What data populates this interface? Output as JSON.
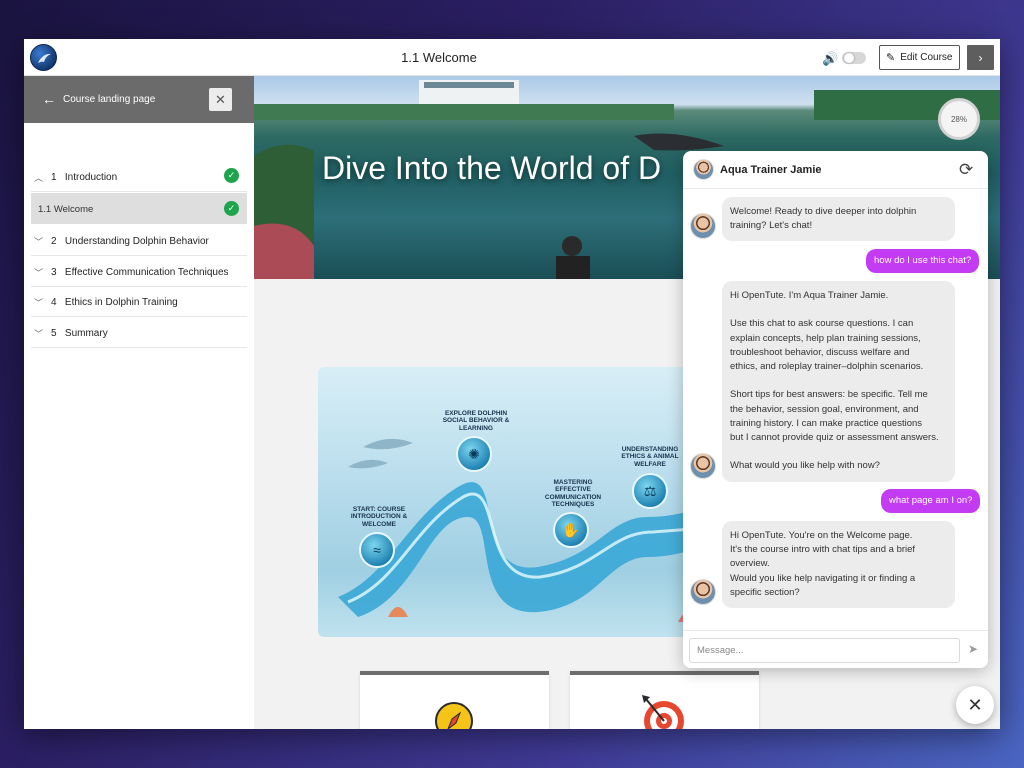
{
  "header": {
    "page_title": "1.1 Welcome",
    "edit_course_label": "Edit Course",
    "icons": {
      "logo": "dolphin-logo-icon",
      "speaker": "speaker-icon",
      "edit": "edit-icon",
      "next": "chevron-right-icon"
    }
  },
  "sidebar": {
    "back_label": "Course landing page",
    "sections": [
      {
        "number": "1",
        "title": "Introduction",
        "expanded": true,
        "completed": true
      },
      {
        "number": "2",
        "title": "Understanding Dolphin Behavior",
        "expanded": false,
        "completed": false
      },
      {
        "number": "3",
        "title": "Effective Communication Techniques",
        "expanded": false,
        "completed": false
      },
      {
        "number": "4",
        "title": "Ethics in Dolphin Training",
        "expanded": false,
        "completed": false
      },
      {
        "number": "5",
        "title": "Summary",
        "expanded": false,
        "completed": false
      }
    ],
    "lessons": [
      {
        "title": "1.1 Welcome",
        "completed": true,
        "active": true
      }
    ]
  },
  "main": {
    "hero_title": "Dive Into the World of D",
    "progress": {
      "label": "28%",
      "value": 0.28
    },
    "roadmap": {
      "stops": [
        {
          "label": "START: COURSE INTRODUCTION & WELCOME",
          "icon": "wave-icon"
        },
        {
          "label": "EXPLORE DOLPHIN SOCIAL BEHAVIOR & LEARNING",
          "icon": "brain-icon"
        },
        {
          "label": "MASTERING EFFECTIVE COMMUNICATION TECHNIQUES",
          "icon": "hand-signal-icon"
        },
        {
          "label": "UNDERSTANDING ETHICS & ANIMAL WELFARE",
          "icon": "scales-icon"
        }
      ]
    },
    "cards": [
      {
        "icon": "compass-icon"
      },
      {
        "icon": "target-icon"
      }
    ]
  },
  "chat": {
    "assistant_name": "Aqua Trainer Jamie",
    "input_placeholder": "Message...",
    "messages": [
      {
        "role": "assistant",
        "text": "Welcome! Ready to dive deeper into dolphin\ntraining? Let's chat!"
      },
      {
        "role": "user",
        "text": "how do I use this chat?"
      },
      {
        "role": "assistant",
        "text": "Hi OpenTute. I'm Aqua Trainer Jamie.\n\nUse this chat to ask course questions. I can\nexplain concepts, help plan training sessions,\ntroubleshoot behavior, discuss welfare and\nethics, and roleplay trainer–dolphin scenarios.\n\nShort tips for best answers: be specific. Tell me\nthe behavior, session goal, environment, and\ntraining history. I can make practice questions\nbut I cannot provide quiz or assessment answers.\n\nWhat would you like help with now?"
      },
      {
        "role": "user",
        "text": "what page am I on?"
      },
      {
        "role": "assistant",
        "text": "Hi OpenTute. You're on the Welcome page.\nIt's the course intro with chat tips and a brief\noverview.\nWould you like help navigating it or finding a\nspecific section?"
      }
    ]
  },
  "colors": {
    "user_bubble": "#c33bf2",
    "bot_bubble": "#ececec",
    "check_green": "#1ea44c",
    "sidebar_header": "#6b6b6b"
  }
}
